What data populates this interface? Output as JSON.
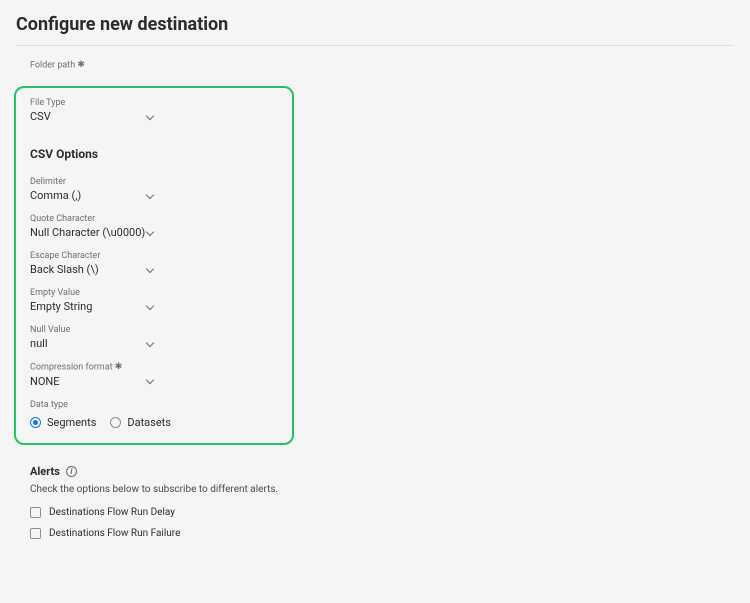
{
  "title": "Configure new destination",
  "folder_path_label": "Folder path",
  "file_type": {
    "label": "File Type",
    "value": "CSV"
  },
  "csv_options_heading": "CSV Options",
  "delimiter": {
    "label": "Delimiter",
    "value": "Comma (,)"
  },
  "quote_char": {
    "label": "Quote Character",
    "value": "Null Character (\\u0000)"
  },
  "escape_char": {
    "label": "Escape Character",
    "value": "Back Slash (\\)"
  },
  "empty_value": {
    "label": "Empty Value",
    "value": "Empty String"
  },
  "null_value": {
    "label": "Null Value",
    "value": "null"
  },
  "compression": {
    "label": "Compression format",
    "value": "NONE"
  },
  "data_type": {
    "label": "Data type",
    "options": [
      "Segments",
      "Datasets"
    ],
    "selected": "Segments"
  },
  "alerts": {
    "title": "Alerts",
    "subtitle": "Check the options below to subscribe to different alerts.",
    "items": [
      "Destinations Flow Run Delay",
      "Destinations Flow Run Failure"
    ]
  }
}
